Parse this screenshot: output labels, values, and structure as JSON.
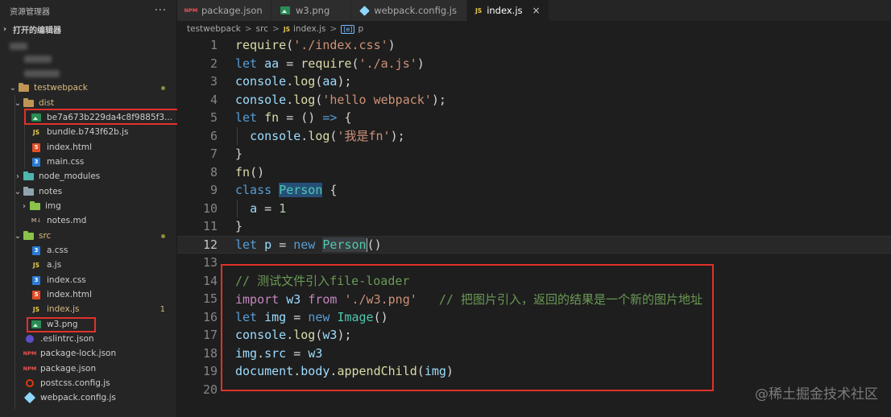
{
  "sidebar": {
    "title": "资源管理器",
    "more": "···",
    "open_editors": "打开的编辑器",
    "project": "testwebpack",
    "items": [
      {
        "label": "testwebpack"
      },
      {
        "label": "dist"
      },
      {
        "label": "be7a673b229da4c8f9885f3..."
      },
      {
        "label": "bundle.b743f62b.js"
      },
      {
        "label": "index.html"
      },
      {
        "label": "main.css"
      },
      {
        "label": "node_modules"
      },
      {
        "label": "notes"
      },
      {
        "label": "img"
      },
      {
        "label": "notes.md"
      },
      {
        "label": "src"
      },
      {
        "label": "a.css"
      },
      {
        "label": "a.js"
      },
      {
        "label": "index.css"
      },
      {
        "label": "index.html"
      },
      {
        "label": "index.js",
        "badge": "1"
      },
      {
        "label": "w3.png"
      },
      {
        "label": ".eslintrc.json"
      },
      {
        "label": "package-lock.json"
      },
      {
        "label": "package.json"
      },
      {
        "label": "postcss.config.js"
      },
      {
        "label": "webpack.config.js"
      }
    ]
  },
  "icons": {
    "js": "JS",
    "html": "5",
    "css": "3",
    "json": "NPM",
    "md": "M↓"
  },
  "tabs": [
    {
      "label": "package.json",
      "icon": "npm-icon"
    },
    {
      "label": "w3.png",
      "icon": "image-icon"
    },
    {
      "label": "webpack.config.js",
      "icon": "webpack-icon"
    },
    {
      "label": "index.js",
      "icon": "js-icon",
      "active": true,
      "close": "×"
    }
  ],
  "breadcrumb": {
    "parts": [
      "testwebpack",
      "src",
      "index.js",
      "p"
    ],
    "sep": ">"
  },
  "editor": {
    "line_numbers": [
      "1",
      "2",
      "3",
      "4",
      "5",
      "6",
      "7",
      "8",
      "9",
      "10",
      "11",
      "12",
      "13",
      "14",
      "15",
      "16",
      "17",
      "18",
      "19",
      "20"
    ],
    "current_line": 12
  },
  "watermark": "@稀土掘金技术社区",
  "colors": {
    "highlight_box": "#e0322b",
    "keyword": "#569cd6",
    "string": "#ce9178",
    "comment": "#6a9955"
  }
}
